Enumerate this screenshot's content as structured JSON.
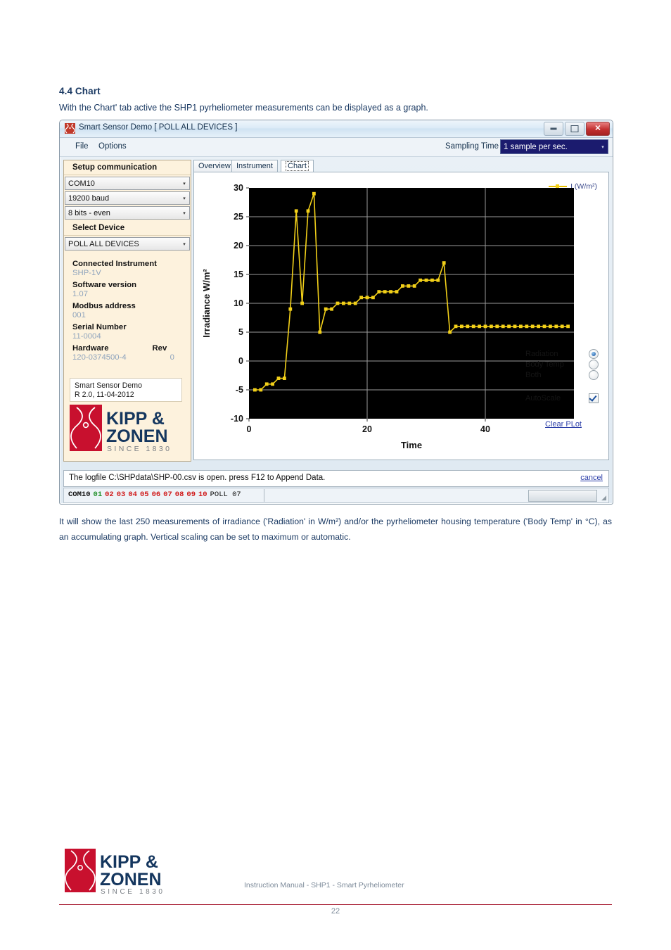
{
  "document": {
    "section_number_title": "4.4 Chart",
    "intro": "With the Chart' tab active the SHP1 pyrheliometer measurements can be displayed as a graph.",
    "after": "It will show the last 250 measurements of irradiance ('Radiation' in W/m²) and/or the pyrheliometer housing temperature ('Body Temp' in °C), as an accumulating graph. Vertical scaling can be set to maximum or automatic.",
    "footer_caption": "Instruction Manual - SHP1 - Smart Pyrheliometer",
    "page_number": "22",
    "brand_line1": "KIPP &",
    "brand_line2": "ZONEN",
    "brand_since": "SINCE 1830",
    "accent_red": "#a6192e",
    "brand_navy": "#1b3a63"
  },
  "window": {
    "title": "Smart Sensor Demo [ POLL ALL DEVICES ]",
    "icon": "kipp-zonen-app-icon",
    "controls": {
      "minimize": "minimize-icon",
      "maximize": "maximize-icon",
      "close": "✕"
    }
  },
  "menubar": {
    "file": "File",
    "options": "Options",
    "sampling_label": "Sampling Time",
    "sampling_value": "1 sample per sec.",
    "sampling_arrow": "▾"
  },
  "sidebar": {
    "setup_header": "Setup communication",
    "com_port": "COM10",
    "baud": "19200 baud",
    "parity": "8 bits - even",
    "select_device_header": "Select Device",
    "device": "POLL ALL DEVICES",
    "combo_arrow": "▾",
    "fields": [
      {
        "label": "Connected Instrument",
        "value": "SHP-1V"
      },
      {
        "label": "Software version",
        "value": "1.07"
      },
      {
        "label": "Modbus address",
        "value": "001"
      },
      {
        "label": "Serial Number",
        "value": "11-0004"
      }
    ],
    "hardware_label": "Hardware",
    "rev_label": "Rev",
    "hardware_value": "120-0374500-4",
    "rev_value": "0",
    "demo_line1": "Smart Sensor Demo",
    "demo_line2": "R 2.0, 11-04-2012",
    "logo_line1": "KIPP &",
    "logo_line2": "ZONEN",
    "logo_since": "SINCE 1830"
  },
  "tabs": [
    {
      "label": "Overview",
      "selected": false
    },
    {
      "label": "Instrument",
      "selected": false
    },
    {
      "label": "Chart",
      "selected": true
    }
  ],
  "chart_controls": {
    "radios": [
      {
        "label": "Radiation",
        "selected": true
      },
      {
        "label": "Body Temp",
        "selected": false
      },
      {
        "label": "Both",
        "selected": false
      }
    ],
    "autoscale_label": "AutoScale",
    "autoscale_checked": true,
    "clear_plot": "Clear PLot"
  },
  "statusbar": {
    "message": "The logfile C:\\SHPdata\\SHP-00.csv is open. press F12 to Append Data.",
    "cancel": "cancel"
  },
  "pollbar": {
    "com": "COM10",
    "addresses": [
      {
        "id": "01",
        "state": "ok"
      },
      {
        "id": "02",
        "state": "fail"
      },
      {
        "id": "03",
        "state": "fail"
      },
      {
        "id": "04",
        "state": "fail"
      },
      {
        "id": "05",
        "state": "fail"
      },
      {
        "id": "06",
        "state": "fail"
      },
      {
        "id": "07",
        "state": "fail"
      },
      {
        "id": "08",
        "state": "fail"
      },
      {
        "id": "09",
        "state": "fail"
      },
      {
        "id": "10",
        "state": "fail"
      }
    ],
    "poll_text": "POLL 07",
    "color_ok": "#1f8f28",
    "color_fail": "#d01a1a"
  },
  "chart_data": {
    "type": "line",
    "title": "",
    "xlabel": "Time",
    "ylabel": "Irradiance W/m²",
    "xlim": [
      0,
      55
    ],
    "ylim": [
      -10,
      30
    ],
    "xticks": [
      0,
      20,
      40
    ],
    "yticks": [
      -10,
      -5,
      0,
      5,
      10,
      15,
      20,
      25,
      30
    ],
    "grid": true,
    "plot_bg": "#000000",
    "series_color": "#f2d019",
    "legend": {
      "label": "I (W/m²)",
      "position": "top-right"
    },
    "series": [
      {
        "name": "I (W/m²)",
        "x": [
          1,
          2,
          3,
          4,
          5,
          6,
          7,
          8,
          9,
          10,
          11,
          12,
          13,
          14,
          15,
          16,
          17,
          18,
          19,
          20,
          21,
          22,
          23,
          24,
          25,
          26,
          27,
          28,
          29,
          30,
          31,
          32,
          33,
          34,
          35,
          36,
          37,
          38,
          39,
          40,
          41,
          42,
          43,
          44,
          45,
          46,
          47,
          48,
          49,
          50,
          51,
          52,
          53,
          54
        ],
        "y": [
          -5,
          -5,
          -4,
          -4,
          -3,
          -3,
          9,
          26,
          10,
          26,
          29,
          5,
          9,
          9,
          10,
          10,
          10,
          10,
          11,
          11,
          11,
          12,
          12,
          12,
          12,
          13,
          13,
          13,
          14,
          14,
          14,
          14,
          17,
          5,
          6,
          6,
          6,
          6,
          6,
          6,
          6,
          6,
          6,
          6,
          6,
          6,
          6,
          6,
          6,
          6,
          6,
          6,
          6,
          6
        ]
      }
    ]
  }
}
